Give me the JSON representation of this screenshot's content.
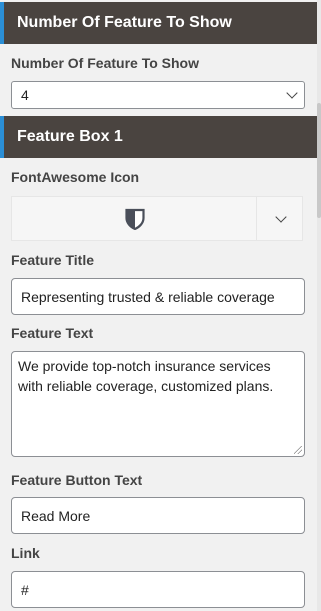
{
  "section_count": {
    "header": "Number Of Feature To Show",
    "label": "Number Of Feature To Show",
    "selected": "4"
  },
  "feature_box": {
    "header": "Feature Box 1",
    "icon_label": "FontAwesome Icon",
    "icon_name": "shield-icon",
    "title_label": "Feature Title",
    "title_value": "Representing trusted & reliable coverage",
    "text_label": "Feature Text",
    "text_value": "We provide top-notch insurance services with reliable coverage, customized plans.",
    "button_label": "Feature Button Text",
    "button_value": "Read More",
    "link_label": "Link",
    "link_value": "#"
  },
  "colors": {
    "header_bg": "#4a4440",
    "accent": "#2b8fd6"
  }
}
